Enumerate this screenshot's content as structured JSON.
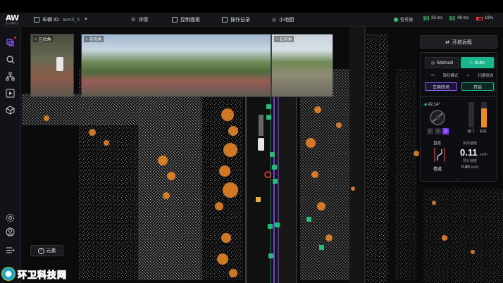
{
  "topbar": {
    "logo_mark": "AW",
    "logo_sub": "无人驾驶环卫",
    "vehicle_id_label": "车辆 ID:",
    "vehicle_id_value": "awv3_5",
    "details_label": "详情",
    "control_panel_label": "控制面板",
    "operation_log_label": "操作记录",
    "minimap_label": "小地图",
    "signal_label": "信号强",
    "latency_1": "33 ms",
    "latency_2": "48 ms",
    "battery": "19%"
  },
  "cameras": [
    {
      "label": "左后角"
    },
    {
      "label": "前视角"
    },
    {
      "label": "右前角"
    }
  ],
  "panel": {
    "remote_button": "开启远程",
    "mode_manual": "Manual",
    "mode_auto": "Auto",
    "sweep_mode_label": "清扫模式",
    "sweep_state_label": "扫擦状态",
    "sweep_mode_value": "车辆转场",
    "sweep_state_value": "开启",
    "steering_angle": "42.14°",
    "gears": [
      "R",
      "N",
      "D"
    ],
    "active_gear": "D",
    "throttle_label": "油门",
    "brake_label": "刹车",
    "throttle_level": 0,
    "brake_level": 0.75,
    "road_label": "直道",
    "lane_action": "借道",
    "actual_speed_label": "实际速度",
    "actual_speed": "0.11",
    "speed_unit": "km/h",
    "expected_speed_label": "预计速度",
    "expected_speed": "0.00",
    "expected_unit": "km/h"
  },
  "map": {
    "elements_button": "元素"
  },
  "watermark": {
    "text": "环卫科技网"
  },
  "colors": {
    "accent_green": "#1db58e",
    "accent_purple": "#7c3aed",
    "orange": "#f08a24"
  }
}
